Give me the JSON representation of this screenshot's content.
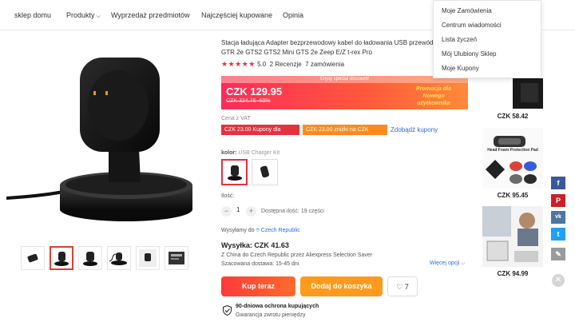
{
  "nav": {
    "items": [
      "sklep domu",
      "Produkty",
      "Wyprzedaż przedmiotów",
      "Najczęściej kupowane",
      "Opinia"
    ]
  },
  "dropdown": {
    "items": [
      "Moje Zamówienia",
      "Centrum wiadomości",
      "Lista życzeń",
      "Mój Ulubiony Sklep",
      "Moje Kupony"
    ]
  },
  "product": {
    "title": "Stacja ładująca Adapter bezprzewodowy kabel do ładowania USB przewód fit GTR2 GTR 2e GTS2 GTS2 Mini GTS 2e Zeep E/Z t-rex Pro",
    "stars": "★★★★★",
    "rating": "5.0",
    "reviews": "2 Recenzje",
    "orders": "7 zamówienia"
  },
  "price": {
    "banner": "Enjoy special discount!",
    "current": "CZK 129.95",
    "old": "CZK 324.76",
    "discount": "-60%",
    "promo_line1": "Promocja dla",
    "promo_line2": "Nowego",
    "promo_line3": "użytkownika"
  },
  "coupons": {
    "vat": "Cena z VAT",
    "coupon1": "CZK 23.00 Kupony dla Ciebie",
    "coupon2": "CZK 23.00 zniżki na CZK 483.00",
    "link": "Zdobądź kupony"
  },
  "color": {
    "label": "kolor:",
    "value": "USB Charger Kit"
  },
  "quantity": {
    "label": "Ilość:",
    "minus": "−",
    "value": "1",
    "plus": "+",
    "available": "Dostępna ilość: 19 części"
  },
  "shipping": {
    "ship_to_label": "Wysyłamy do",
    "ship_to_country": "Czech Republic",
    "title": "Wysyłka: CZK 41.63",
    "line1": "Z China do Czech Republic przez Aliexpress Selection Saver",
    "line2": "Szacowana dostawa: 15-45 dni",
    "more": "Więcej opcji ⌵"
  },
  "actions": {
    "buy": "Kup teraz",
    "cart": "Dodaj do koszyka",
    "wish_count": "7"
  },
  "protection": {
    "title": "90-dniowa ochrona kupujących",
    "subtitle": "Gwarancja zwrotu pieniędzy"
  },
  "recommendations": {
    "prices": [
      "CZK 58.42",
      "CZK 95.45",
      "CZK 94.99"
    ],
    "caption2": "Head Foam Protection Pad"
  },
  "share": {
    "facebook": "f",
    "pinterest": "P",
    "vk": "vk",
    "twitter": "t",
    "edit": "✎",
    "close": "✕"
  },
  "colors": {
    "accent": "#e8313e",
    "link": "#2a6ee0",
    "cart": "#ff9a1c"
  }
}
